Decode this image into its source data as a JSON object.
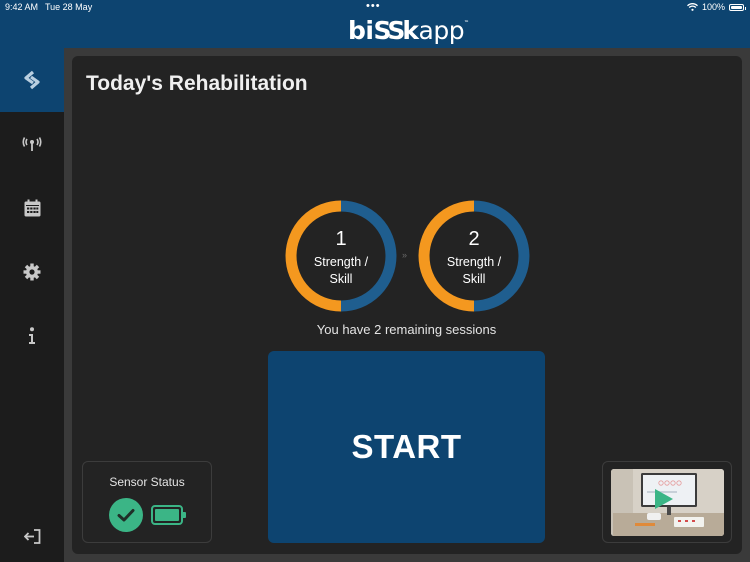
{
  "status_bar": {
    "time": "9:42 AM",
    "date": "Tue 28 May",
    "dots": "•••",
    "battery_percent": "100%",
    "wifi_icon": "wifi-icon",
    "battery_icon": "battery-icon"
  },
  "app": {
    "logo_bold": "bi",
    "logo_mark": "SS",
    "logo_bold2": "k",
    "logo_thin": "app",
    "logo_tm": "™"
  },
  "sidebar": {
    "items": [
      {
        "icon": "app-logo-icon",
        "active": true
      },
      {
        "icon": "antenna-icon",
        "active": false
      },
      {
        "icon": "calendar-icon",
        "active": false
      },
      {
        "icon": "gear-icon",
        "active": false
      },
      {
        "icon": "info-icon",
        "active": false
      },
      {
        "icon": "logout-icon",
        "active": false
      }
    ]
  },
  "main": {
    "title": "Today's Rehabilitation",
    "sessions": [
      {
        "number": "1",
        "label_line1": "Strength /",
        "label_line2": "Skill"
      },
      {
        "number": "2",
        "label_line1": "Strength /",
        "label_line2": "Skill"
      }
    ],
    "separator": "»",
    "remaining_text": "You have 2 remaining sessions",
    "start_label": "START"
  },
  "sensor_status": {
    "title": "Sensor Status",
    "connected_icon": "check-circle-icon",
    "battery_icon": "battery-full-icon"
  },
  "video": {
    "thumbnail_icon": "play-icon"
  },
  "colors": {
    "brand_blue": "#0d4470",
    "ring_orange": "#f4981f",
    "ring_blue": "#1f5e8f",
    "status_green": "#3bb586",
    "panel_dark": "#232323"
  }
}
